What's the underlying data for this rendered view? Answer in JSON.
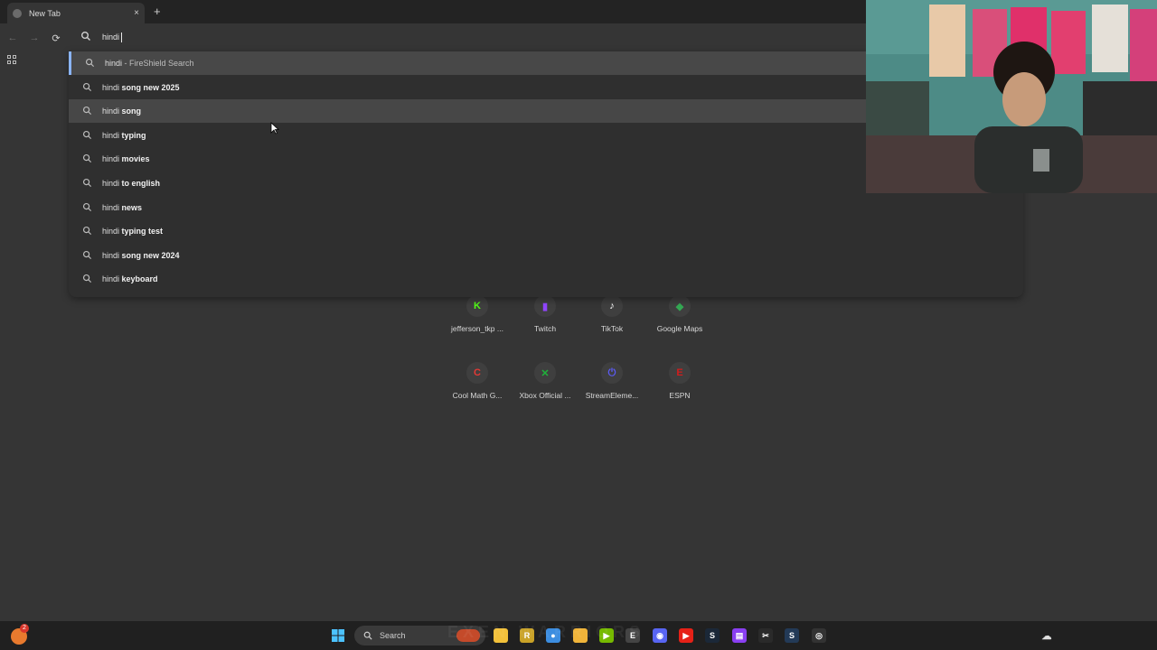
{
  "tab": {
    "title": "New Tab",
    "close_glyph": "×"
  },
  "new_tab_glyph": "+",
  "toolbar": {
    "back_glyph": "←",
    "forward_glyph": "→",
    "reload_glyph": "⟳"
  },
  "omnibox": {
    "value": "hindi"
  },
  "suggestions": [
    {
      "prefix": "hindi",
      "completion": "",
      "desc": " - FireShield Search"
    },
    {
      "prefix": "hindi",
      "completion": " song new 2025",
      "desc": ""
    },
    {
      "prefix": "hindi",
      "completion": " song",
      "desc": ""
    },
    {
      "prefix": "hindi",
      "completion": " typing",
      "desc": ""
    },
    {
      "prefix": "hindi",
      "completion": " movies",
      "desc": ""
    },
    {
      "prefix": "hindi",
      "completion": " to english",
      "desc": ""
    },
    {
      "prefix": "hindi",
      "completion": " news",
      "desc": ""
    },
    {
      "prefix": "hindi",
      "completion": " typing test",
      "desc": ""
    },
    {
      "prefix": "hindi",
      "completion": " song new 2024",
      "desc": ""
    },
    {
      "prefix": "hindi",
      "completion": " keyboard",
      "desc": ""
    }
  ],
  "shortcuts": [
    {
      "label": "jefferson_tkp ...",
      "glyph": "K",
      "color": "#53fc18",
      "icon": "kick-icon"
    },
    {
      "label": "Twitch",
      "glyph": "▮",
      "color": "#9146ff",
      "icon": "twitch-icon"
    },
    {
      "label": "TikTok",
      "glyph": "♪",
      "color": "#ffffff",
      "icon": "tiktok-icon"
    },
    {
      "label": "Google Maps",
      "glyph": "◆",
      "color": "#34a853",
      "icon": "google-maps-icon"
    },
    {
      "label": "Cool Math G...",
      "glyph": "C",
      "color": "#e53935",
      "icon": "coolmath-icon"
    },
    {
      "label": "Xbox Official ...",
      "glyph": "✕",
      "color": "#1fb23a",
      "icon": "xbox-icon"
    },
    {
      "label": "StreamEleme...",
      "glyph": "⏻",
      "color": "#5b5bf5",
      "icon": "streamelements-icon"
    },
    {
      "label": "ESPN",
      "glyph": "E",
      "color": "#d11d1d",
      "icon": "espn-icon"
    }
  ],
  "taskbar": {
    "search_label": "Search",
    "badge": "2",
    "watermark": "EXEN WARRIORS",
    "apps": [
      {
        "name": "file-explorer-icon",
        "color": "#f3c13a",
        "glyph": ""
      },
      {
        "name": "roblox-icon",
        "color": "#c9a227",
        "glyph": "R"
      },
      {
        "name": "chrome-icon",
        "color": "#3c8de0",
        "glyph": "●"
      },
      {
        "name": "folder-icon",
        "color": "#f0b43a",
        "glyph": ""
      },
      {
        "name": "nvidia-icon",
        "color": "#76b900",
        "glyph": "▶"
      },
      {
        "name": "epic-games-icon",
        "color": "#444444",
        "glyph": "E"
      },
      {
        "name": "discord-icon",
        "color": "#5865f2",
        "glyph": "◉"
      },
      {
        "name": "youtube-icon",
        "color": "#e62117",
        "glyph": "▶"
      },
      {
        "name": "steam-icon",
        "color": "#1b2838",
        "glyph": "S"
      },
      {
        "name": "video-editor-icon",
        "color": "#8a3ff2",
        "glyph": "▤"
      },
      {
        "name": "capcut-icon",
        "color": "#2a2a2a",
        "glyph": "✂"
      },
      {
        "name": "steam-client-icon",
        "color": "#233a57",
        "glyph": "S"
      },
      {
        "name": "obs-icon",
        "color": "#333333",
        "glyph": "◎"
      }
    ]
  },
  "colors": {
    "background": "#353535",
    "dropdown": "#2f2f2f",
    "accent": "#8ab4f8"
  }
}
